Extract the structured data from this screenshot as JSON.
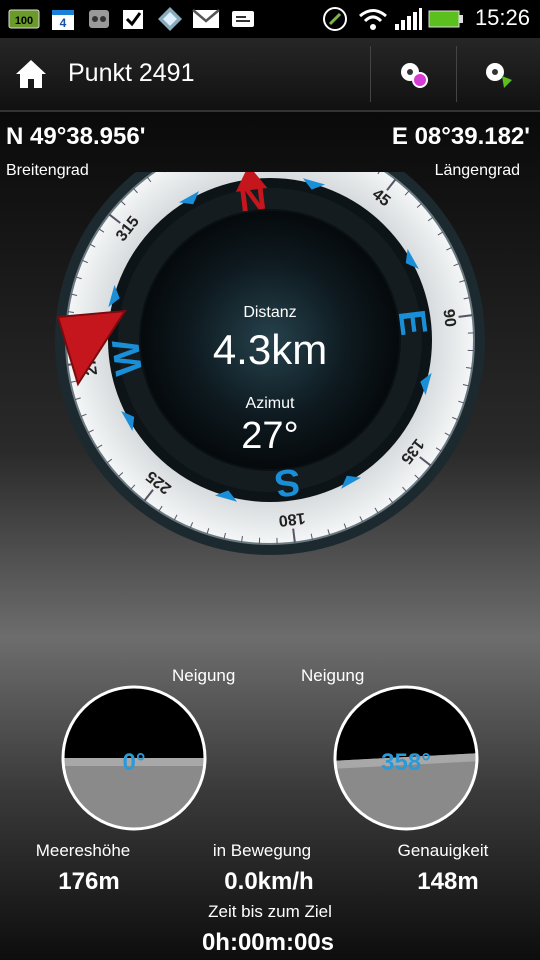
{
  "status_bar": {
    "time": "15:26",
    "battery_badge": "100",
    "calendar_badge": "4",
    "icons": [
      "battery-badge-icon",
      "calendar-icon",
      "voicemail-icon",
      "task-check-icon",
      "sync-icon",
      "gmail-icon",
      "message-icon",
      "nfc-icon",
      "wifi-icon",
      "signal-icon",
      "battery-icon"
    ]
  },
  "action_bar": {
    "title": "Punkt 2491",
    "home_icon": "home-icon",
    "buttons": [
      "waypoint-settings-icon",
      "waypoint-navigate-icon"
    ]
  },
  "coordinates": {
    "latitude": "N 49°38.956'",
    "latitude_label": "Breitengrad",
    "longitude": "E 08°39.182'",
    "longitude_label": "Längengrad"
  },
  "compass": {
    "distance_label": "Distanz",
    "distance_value": "4.3km",
    "azimuth_label": "Azimut",
    "azimuth_value": "27°",
    "heading_deg": -7,
    "ring_ticks": [
      "0",
      "45",
      "90",
      "135",
      "180",
      "225",
      "270",
      "315"
    ],
    "cardinals": [
      "N",
      "E",
      "S",
      "W"
    ],
    "colors": {
      "north": "#c4161c",
      "cardinal": "#1a8fd8",
      "marker": "#c4161c"
    }
  },
  "tilt": {
    "left": {
      "label": "Neigung",
      "value": "0°"
    },
    "right": {
      "label": "Neigung",
      "value": "358°"
    },
    "value_color": "#2b9ad9"
  },
  "stats": {
    "altitude_label": "Meereshöhe",
    "altitude_value": "176m",
    "moving_label": "in Bewegung",
    "moving_value": "0.0km/h",
    "accuracy_label": "Genauigkeit",
    "accuracy_value": "148m",
    "eta_label": "Zeit bis zum Ziel",
    "eta_value": "0h:00m:00s"
  }
}
